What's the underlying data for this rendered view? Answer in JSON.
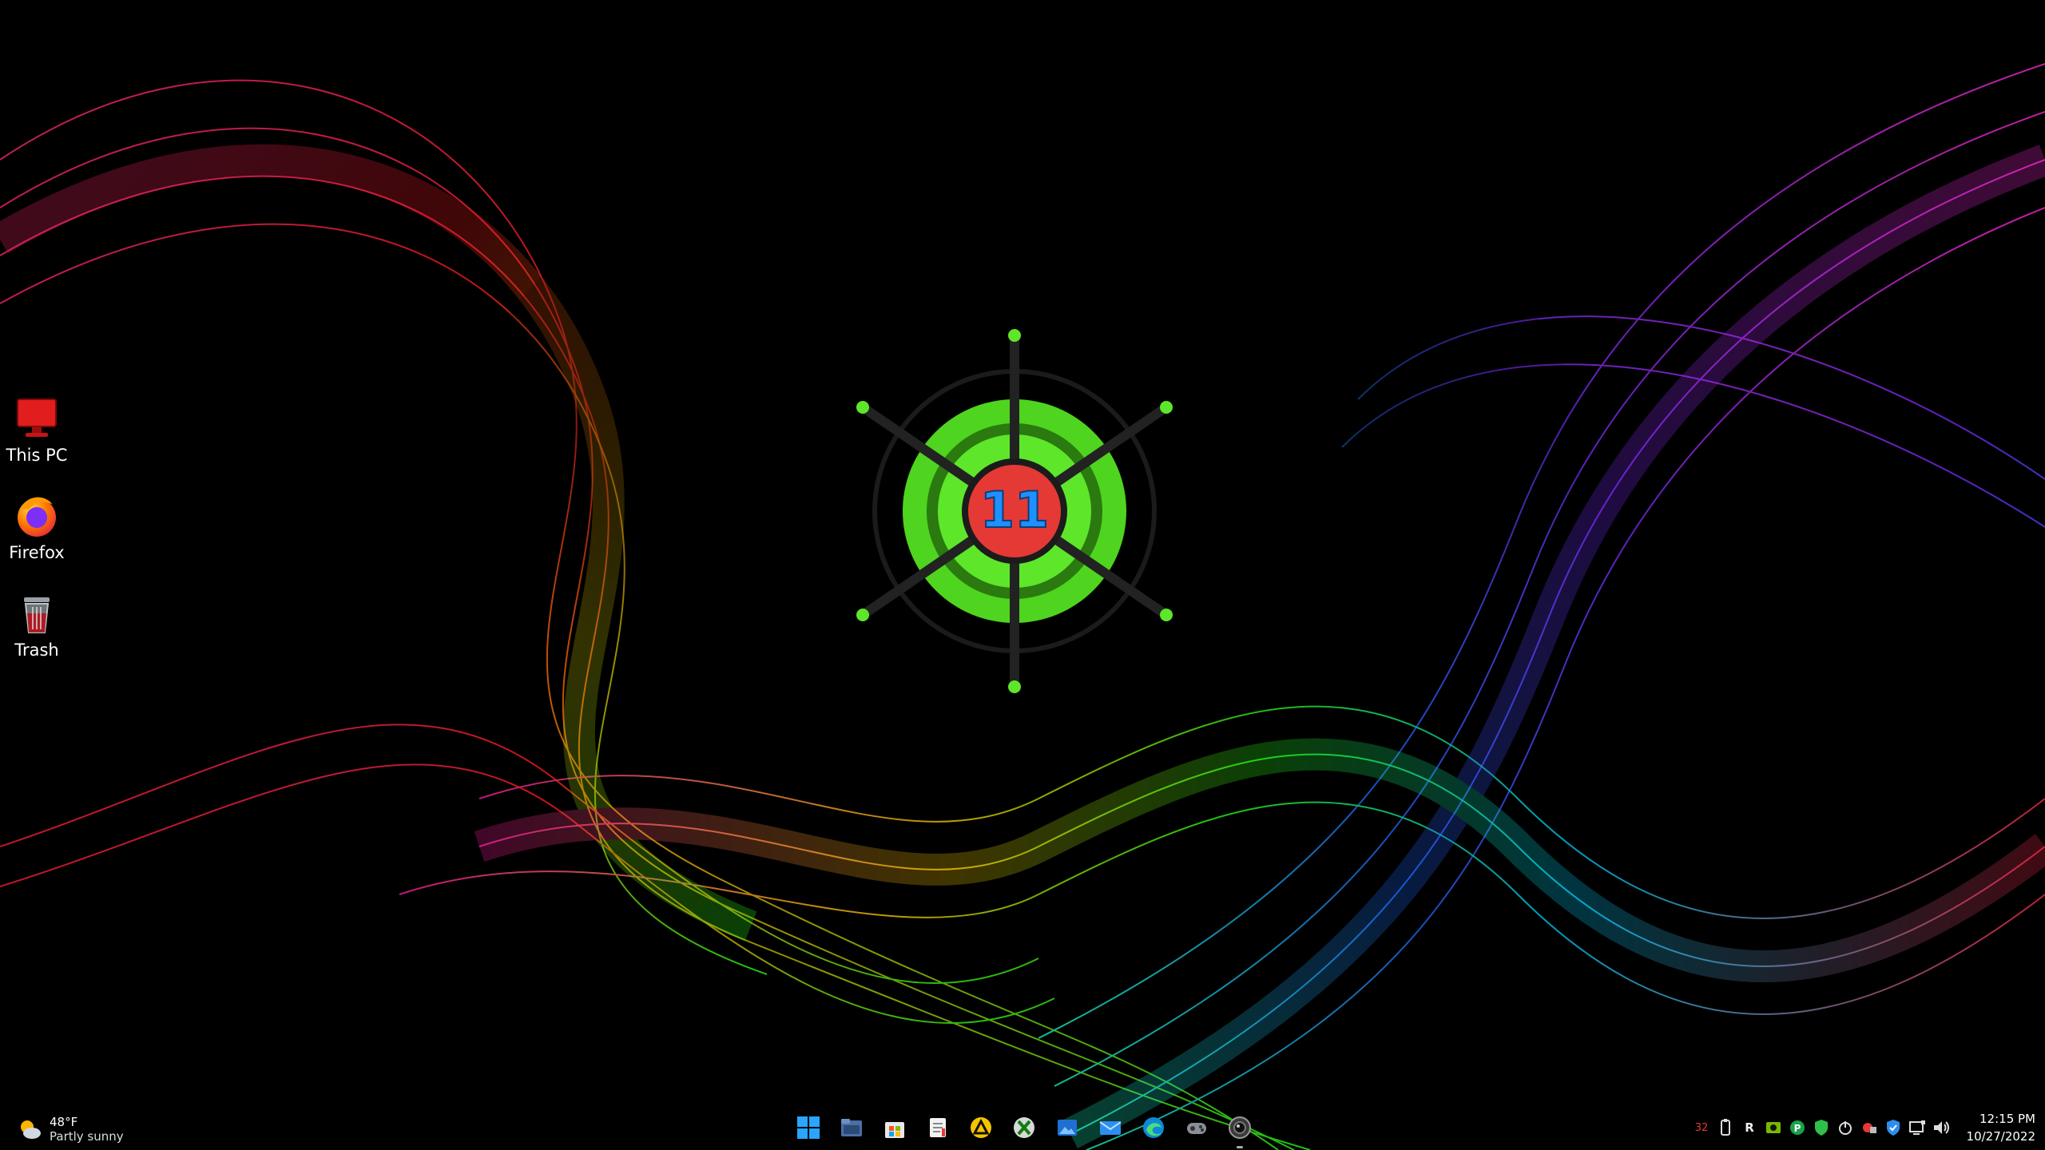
{
  "desktop": {
    "icons": [
      {
        "label": "This PC",
        "icon": "monitor-icon"
      },
      {
        "label": "Firefox",
        "icon": "firefox-icon"
      },
      {
        "label": "Trash",
        "icon": "trash-icon"
      }
    ],
    "logo_text": "11"
  },
  "taskbar": {
    "weather": {
      "temp": "48°F",
      "condition": "Partly sunny",
      "icon": "partly-sunny-icon"
    },
    "pinned": [
      {
        "name": "start",
        "icon": "windows-start-icon"
      },
      {
        "name": "explorer",
        "icon": "file-explorer-icon"
      },
      {
        "name": "store",
        "icon": "microsoft-store-icon"
      },
      {
        "name": "notepad",
        "icon": "notepad-icon"
      },
      {
        "name": "app",
        "icon": "triangle-app-icon"
      },
      {
        "name": "xbox",
        "icon": "xbox-icon"
      },
      {
        "name": "photos",
        "icon": "photos-icon"
      },
      {
        "name": "mail",
        "icon": "mail-icon"
      },
      {
        "name": "edge",
        "icon": "edge-icon"
      },
      {
        "name": "gamepad",
        "icon": "gamepad-icon"
      },
      {
        "name": "camera",
        "icon": "camera-app-icon"
      }
    ],
    "tray": [
      {
        "icon": "temperature-icon",
        "text": "32"
      },
      {
        "icon": "usb-icon",
        "text": ""
      },
      {
        "icon": "app-r-icon",
        "text": "R"
      },
      {
        "icon": "nvidia-icon",
        "text": ""
      },
      {
        "icon": "p-icon",
        "text": "P"
      },
      {
        "icon": "shield-icon",
        "text": ""
      },
      {
        "icon": "power-icon",
        "text": ""
      },
      {
        "icon": "security-icon",
        "text": ""
      },
      {
        "icon": "defender-icon",
        "text": ""
      },
      {
        "icon": "network-icon",
        "text": ""
      },
      {
        "icon": "volume-icon",
        "text": ""
      }
    ],
    "clock": {
      "time": "12:15 PM",
      "date": "10/27/2022"
    }
  },
  "colors": {
    "accent": "#e53935",
    "logo_green": "#5ee62a",
    "logo_blue": "#1e90ff"
  }
}
